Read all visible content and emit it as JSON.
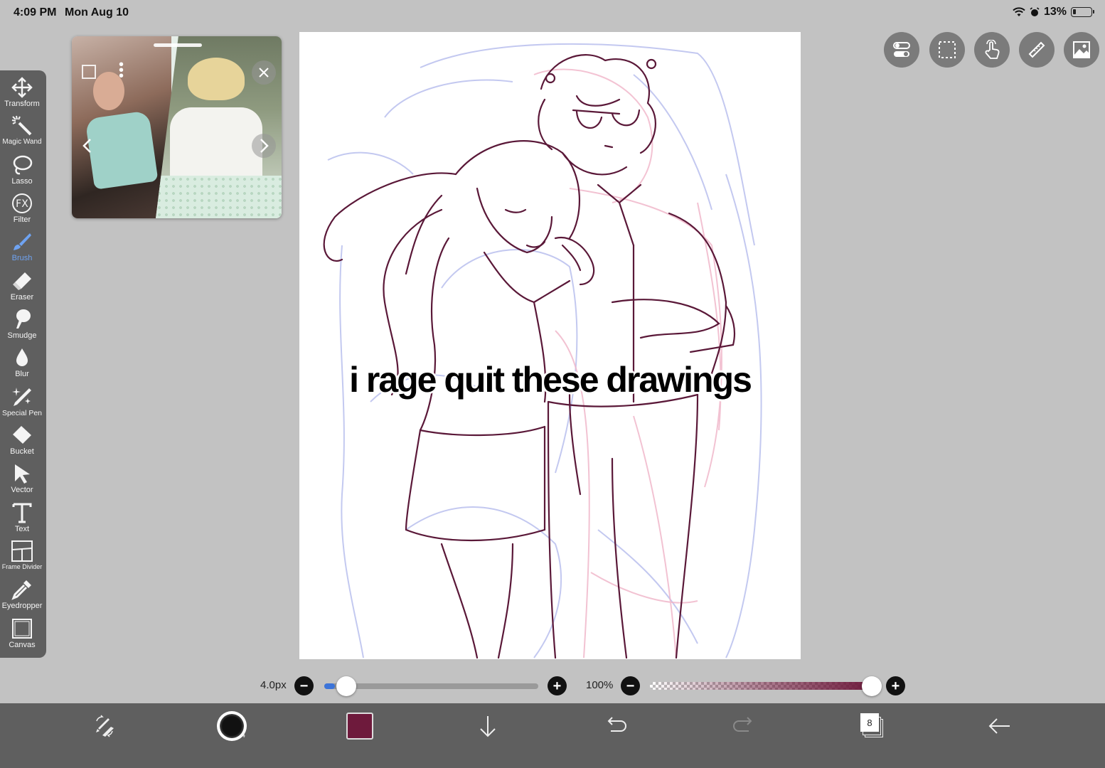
{
  "status": {
    "time": "4:09 PM",
    "date": "Mon Aug 10",
    "battery": "13%"
  },
  "caption": "i rage quit these drawings",
  "tools": [
    {
      "id": "transform",
      "label": "Transform",
      "icon": "move-arrows-icon"
    },
    {
      "id": "magic-wand",
      "label": "Magic Wand",
      "icon": "magic-wand-icon"
    },
    {
      "id": "lasso",
      "label": "Lasso",
      "icon": "lasso-icon"
    },
    {
      "id": "filter",
      "label": "Filter",
      "icon": "fx-icon"
    },
    {
      "id": "brush",
      "label": "Brush",
      "icon": "brush-icon",
      "active": true
    },
    {
      "id": "eraser",
      "label": "Eraser",
      "icon": "eraser-icon"
    },
    {
      "id": "smudge",
      "label": "Smudge",
      "icon": "smudge-icon"
    },
    {
      "id": "blur",
      "label": "Blur",
      "icon": "drop-icon"
    },
    {
      "id": "special-pen",
      "label": "Special Pen",
      "icon": "sparkle-pen-icon"
    },
    {
      "id": "bucket",
      "label": "Bucket",
      "icon": "bucket-icon"
    },
    {
      "id": "vector",
      "label": "Vector",
      "icon": "cursor-arrow-icon"
    },
    {
      "id": "text",
      "label": "Text",
      "icon": "text-t-icon"
    },
    {
      "id": "frame-divider",
      "label": "Frame Divider",
      "icon": "frame-divider-icon"
    },
    {
      "id": "eyedropper",
      "label": "Eyedropper",
      "icon": "eyedropper-icon"
    },
    {
      "id": "canvas",
      "label": "Canvas",
      "icon": "canvas-square-icon"
    }
  ],
  "brush": {
    "size_label": "4.0px",
    "size_level": 0.05,
    "opacity_label": "100%",
    "opacity_level": 1.0,
    "preview_number": "4",
    "color": "#6e1a3c"
  },
  "layers": {
    "count": "8"
  },
  "colors": {
    "accent": "#6fa3f2",
    "toolbar_bg": "#5f5f5f",
    "background": "#c2c2c2"
  }
}
